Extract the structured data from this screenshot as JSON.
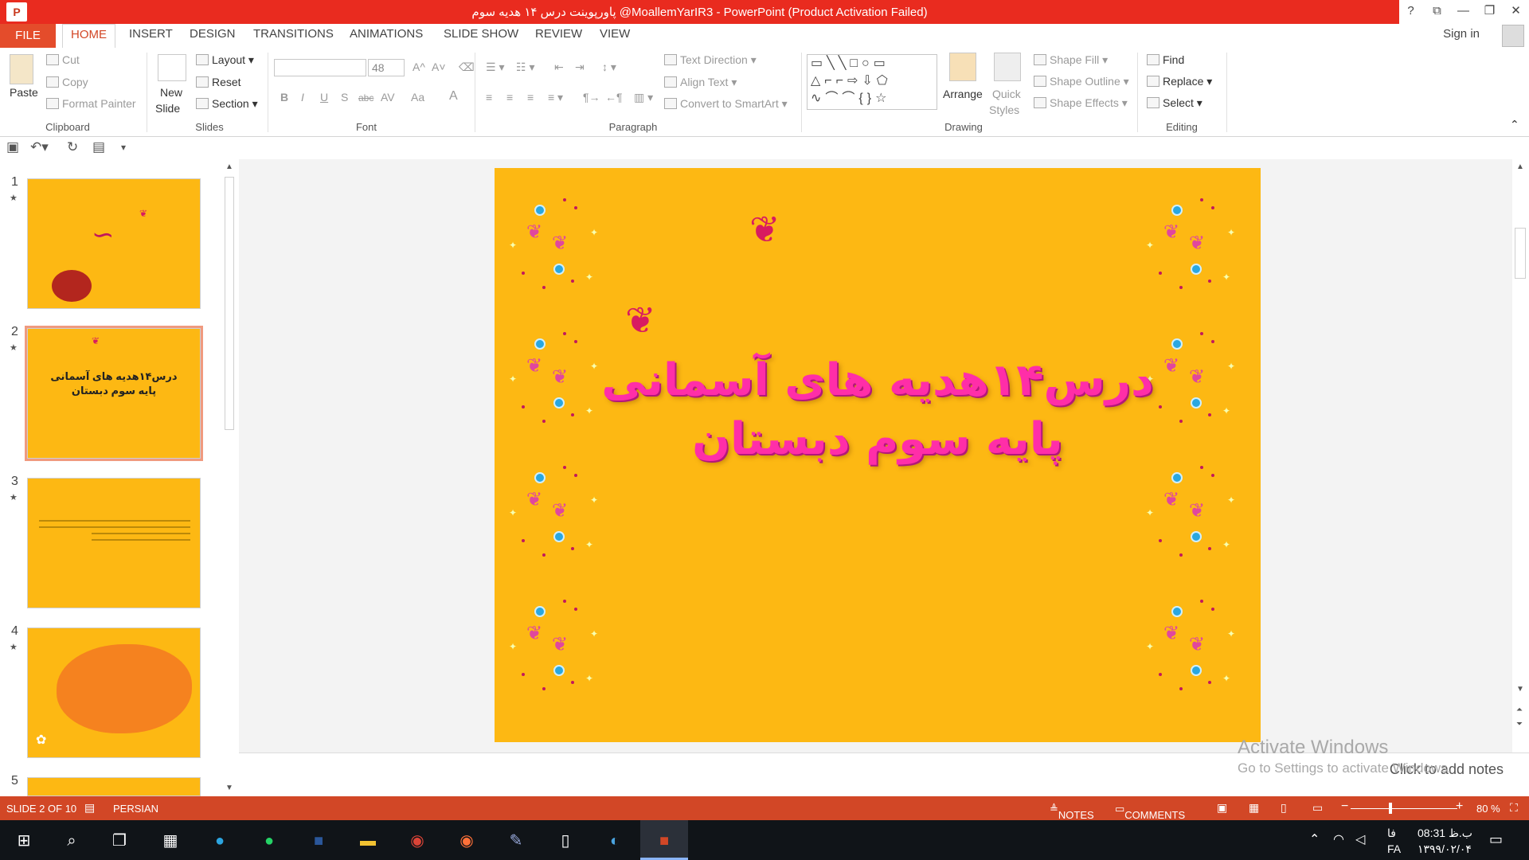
{
  "window": {
    "title": "پاورپوینت درس ۱۴ هدیه سوم @MoallemYarIR3 - PowerPoint (Product Activation Failed)",
    "app_icon": "P",
    "controls": [
      "?",
      "⧉",
      "—",
      "❐",
      "✕"
    ]
  },
  "tabs": {
    "file": "FILE",
    "items": [
      "HOME",
      "INSERT",
      "DESIGN",
      "TRANSITIONS",
      "ANIMATIONS",
      "SLIDE SHOW",
      "REVIEW",
      "VIEW"
    ],
    "active": "HOME",
    "sign_in": "Sign in"
  },
  "ribbon": {
    "clipboard": {
      "paste": "Paste",
      "cut": "Cut",
      "copy": "Copy",
      "format_painter": "Format Painter",
      "label": "Clipboard"
    },
    "slides": {
      "new_slide_1": "New",
      "new_slide_2": "Slide",
      "layout": "Layout",
      "reset": "Reset",
      "section": "Section",
      "label": "Slides"
    },
    "font": {
      "font_name": "",
      "font_size": "48",
      "label": "Font",
      "buttons": [
        "B",
        "I",
        "U",
        "S",
        "abc",
        "AV",
        "Aa",
        "A"
      ]
    },
    "paragraph": {
      "text_direction": "Text Direction",
      "align_text": "Align Text",
      "convert_smartart": "Convert to SmartArt",
      "label": "Paragraph"
    },
    "drawing": {
      "arrange": "Arrange",
      "quick_styles_1": "Quick",
      "quick_styles_2": "Styles",
      "shape_fill": "Shape Fill",
      "shape_outline": "Shape Outline",
      "shape_effects": "Shape Effects",
      "label": "Drawing"
    },
    "editing": {
      "find": "Find",
      "replace": "Replace",
      "select": "Select",
      "label": "Editing"
    }
  },
  "thumbnails": [
    {
      "num": "1",
      "text": ""
    },
    {
      "num": "2",
      "text_line1": "درس۱۴هدیه های آسمانی",
      "text_line2": "پایه سوم دبستان"
    },
    {
      "num": "3",
      "text": ""
    },
    {
      "num": "4",
      "text": ""
    },
    {
      "num": "5",
      "text": ""
    }
  ],
  "slide": {
    "title_line1": "درس۱۴هدیه های آسمانی",
    "title_line2": "پایه سوم دبستان",
    "background": "#fdb813",
    "title_color": "#ff2ea8"
  },
  "notes": {
    "placeholder": "Click to add notes"
  },
  "watermark": {
    "line1": "Activate Windows",
    "line2": "Go to Settings to activate Windows."
  },
  "status": {
    "slide_info": "SLIDE 2 OF 10",
    "language": "PERSIAN",
    "notes": "NOTES",
    "comments": "COMMENTS",
    "zoom": "80 %"
  },
  "taskbar": {
    "time": "08:31 ب.ظ",
    "date": "۱۳۹۹/۰۲/۰۴",
    "lang": "FA",
    "lang2": "فا"
  }
}
